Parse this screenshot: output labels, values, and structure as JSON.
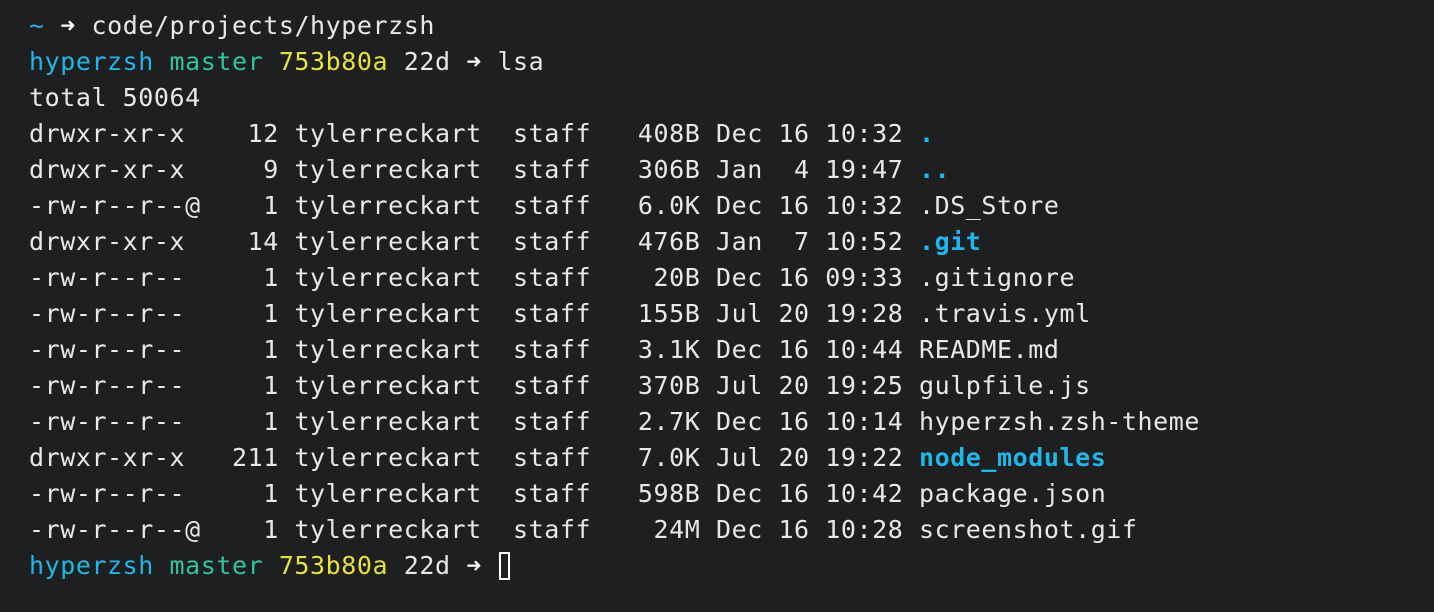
{
  "path_line": {
    "tilde": "~",
    "arrow": "➜",
    "directory": "code/projects/hyperzsh"
  },
  "prompt": {
    "repo": "hyperzsh",
    "branch": "master",
    "hash": "753b80a",
    "age": "22d",
    "arrow": "➜",
    "command": "lsa"
  },
  "total_line": "total 50064",
  "listing": [
    {
      "perms": "drwxr-xr-x ",
      "links": " 12",
      "owner": "tylerreckart",
      "group": "staff",
      "size": " 408B",
      "date": "Dec 16 10:32",
      "name": ".",
      "kind": "dir"
    },
    {
      "perms": "drwxr-xr-x ",
      "links": "  9",
      "owner": "tylerreckart",
      "group": "staff",
      "size": " 306B",
      "date": "Jan  4 19:47",
      "name": "..",
      "kind": "dir"
    },
    {
      "perms": "-rw-r--r--@",
      "links": "  1",
      "owner": "tylerreckart",
      "group": "staff",
      "size": " 6.0K",
      "date": "Dec 16 10:32",
      "name": ".DS_Store",
      "kind": "file"
    },
    {
      "perms": "drwxr-xr-x ",
      "links": " 14",
      "owner": "tylerreckart",
      "group": "staff",
      "size": " 476B",
      "date": "Jan  7 10:52",
      "name": ".git",
      "kind": "dir"
    },
    {
      "perms": "-rw-r--r-- ",
      "links": "  1",
      "owner": "tylerreckart",
      "group": "staff",
      "size": "  20B",
      "date": "Dec 16 09:33",
      "name": ".gitignore",
      "kind": "file"
    },
    {
      "perms": "-rw-r--r-- ",
      "links": "  1",
      "owner": "tylerreckart",
      "group": "staff",
      "size": " 155B",
      "date": "Jul 20 19:28",
      "name": ".travis.yml",
      "kind": "file"
    },
    {
      "perms": "-rw-r--r-- ",
      "links": "  1",
      "owner": "tylerreckart",
      "group": "staff",
      "size": " 3.1K",
      "date": "Dec 16 10:44",
      "name": "README.md",
      "kind": "file"
    },
    {
      "perms": "-rw-r--r-- ",
      "links": "  1",
      "owner": "tylerreckart",
      "group": "staff",
      "size": " 370B",
      "date": "Jul 20 19:25",
      "name": "gulpfile.js",
      "kind": "file"
    },
    {
      "perms": "-rw-r--r-- ",
      "links": "  1",
      "owner": "tylerreckart",
      "group": "staff",
      "size": " 2.7K",
      "date": "Dec 16 10:14",
      "name": "hyperzsh.zsh-theme",
      "kind": "file"
    },
    {
      "perms": "drwxr-xr-x ",
      "links": "211",
      "owner": "tylerreckart",
      "group": "staff",
      "size": " 7.0K",
      "date": "Jul 20 19:22",
      "name": "node_modules",
      "kind": "dir"
    },
    {
      "perms": "-rw-r--r-- ",
      "links": "  1",
      "owner": "tylerreckart",
      "group": "staff",
      "size": " 598B",
      "date": "Dec 16 10:42",
      "name": "package.json",
      "kind": "file"
    },
    {
      "perms": "-rw-r--r--@",
      "links": "  1",
      "owner": "tylerreckart",
      "group": "staff",
      "size": "  24M",
      "date": "Dec 16 10:28",
      "name": "screenshot.gif",
      "kind": "file"
    }
  ],
  "final_prompt": {
    "repo": "hyperzsh",
    "branch": "master",
    "hash": "753b80a",
    "age": "22d",
    "arrow": "➜"
  },
  "colors": {
    "background": "#1d1f21",
    "foreground": "#e8e8e8",
    "directory": "#1fb6e8",
    "branch": "#2ec4a0",
    "hash": "#e6e23b"
  }
}
